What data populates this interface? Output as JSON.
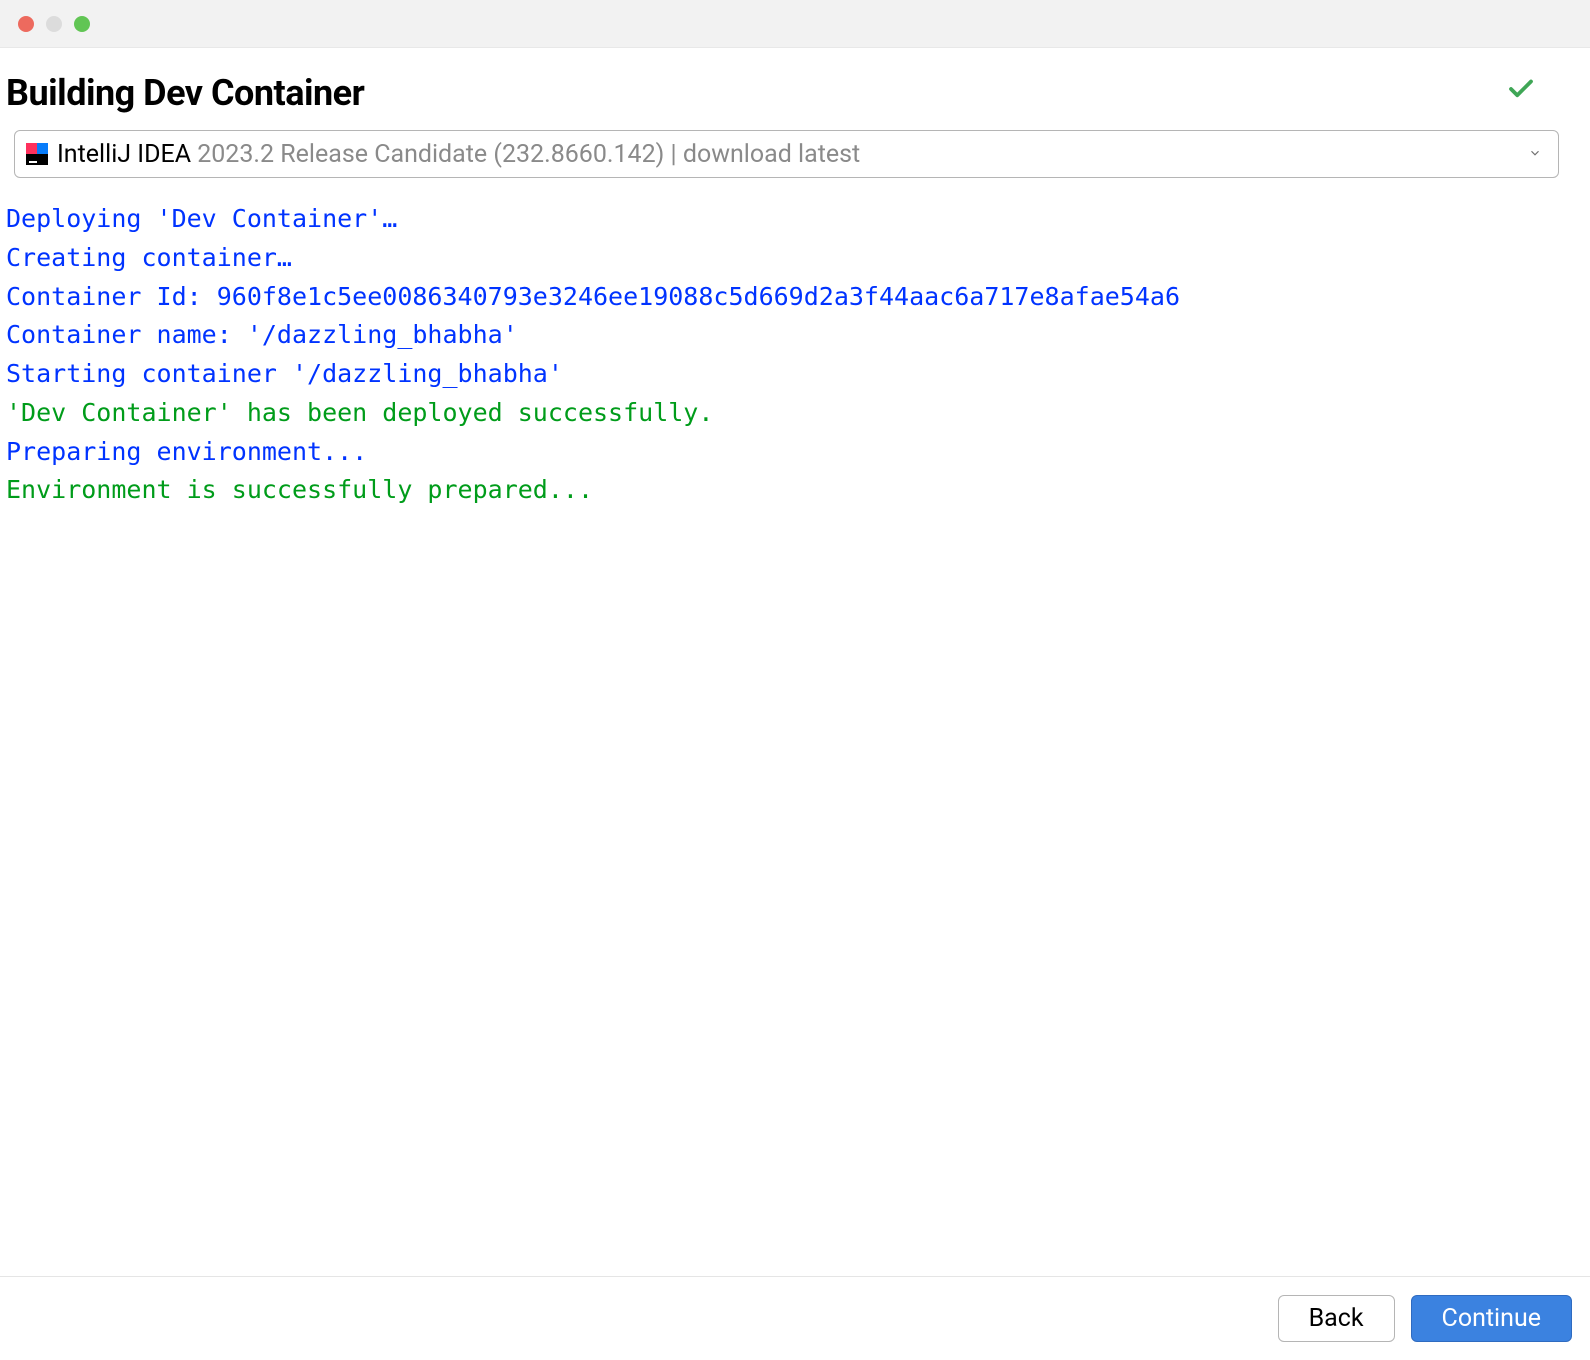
{
  "header": {
    "title": "Building Dev Container"
  },
  "dropdown": {
    "product": "IntelliJ IDEA",
    "version": " 2023.2 Release Candidate (232.8660.142) | download latest"
  },
  "log": {
    "lines": [
      {
        "text": "Deploying 'Dev Container'…",
        "cls": "log-blue"
      },
      {
        "text": "Creating container…",
        "cls": "log-blue"
      },
      {
        "text": "Container Id: 960f8e1c5ee0086340793e3246ee19088c5d669d2a3f44aac6a717e8afae54a6",
        "cls": "log-blue"
      },
      {
        "text": "Container name: '/dazzling_bhabha'",
        "cls": "log-blue"
      },
      {
        "text": "Starting container '/dazzling_bhabha'",
        "cls": "log-blue"
      },
      {
        "text": "'Dev Container' has been deployed successfully.",
        "cls": "log-green"
      },
      {
        "text": "Preparing environment...",
        "cls": "log-blue"
      },
      {
        "text": "Environment is successfully prepared...",
        "cls": "log-green"
      }
    ]
  },
  "footer": {
    "back_label": "Back",
    "continue_label": "Continue"
  }
}
